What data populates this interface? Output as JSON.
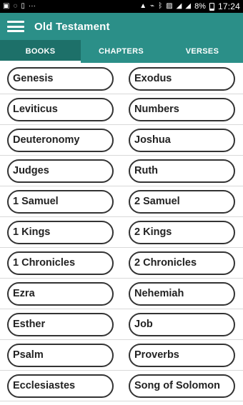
{
  "status_bar": {
    "icons": [
      "image-icon",
      "message-icon",
      "notification-icon",
      "more-dots-icon",
      "lock-icon",
      "signal-icon",
      "bluetooth-icon",
      "screenshot-icon",
      "wifi-icon",
      "cellular-icon"
    ],
    "more": "···",
    "battery": "8%",
    "time": "17:24"
  },
  "app_bar": {
    "title": "Old Testament"
  },
  "tabs": [
    {
      "label": "BOOKS",
      "active": true
    },
    {
      "label": "CHAPTERS",
      "active": false
    },
    {
      "label": "VERSES",
      "active": false
    }
  ],
  "books": [
    [
      "Genesis",
      "Exodus"
    ],
    [
      "Leviticus",
      "Numbers"
    ],
    [
      "Deuteronomy",
      "Joshua"
    ],
    [
      "Judges",
      "Ruth"
    ],
    [
      "1 Samuel",
      "2 Samuel"
    ],
    [
      "1 Kings",
      "2 Kings"
    ],
    [
      "1 Chronicles",
      "2 Chronicles"
    ],
    [
      "Ezra",
      "Nehemiah"
    ],
    [
      "Esther",
      "Job"
    ],
    [
      "Psalm",
      "Proverbs"
    ],
    [
      "Ecclesiastes",
      "Song of Solomon"
    ]
  ],
  "colors": {
    "primary": "#2b8f88",
    "active_tab": "#1d7069",
    "status_bar": "#000000"
  }
}
